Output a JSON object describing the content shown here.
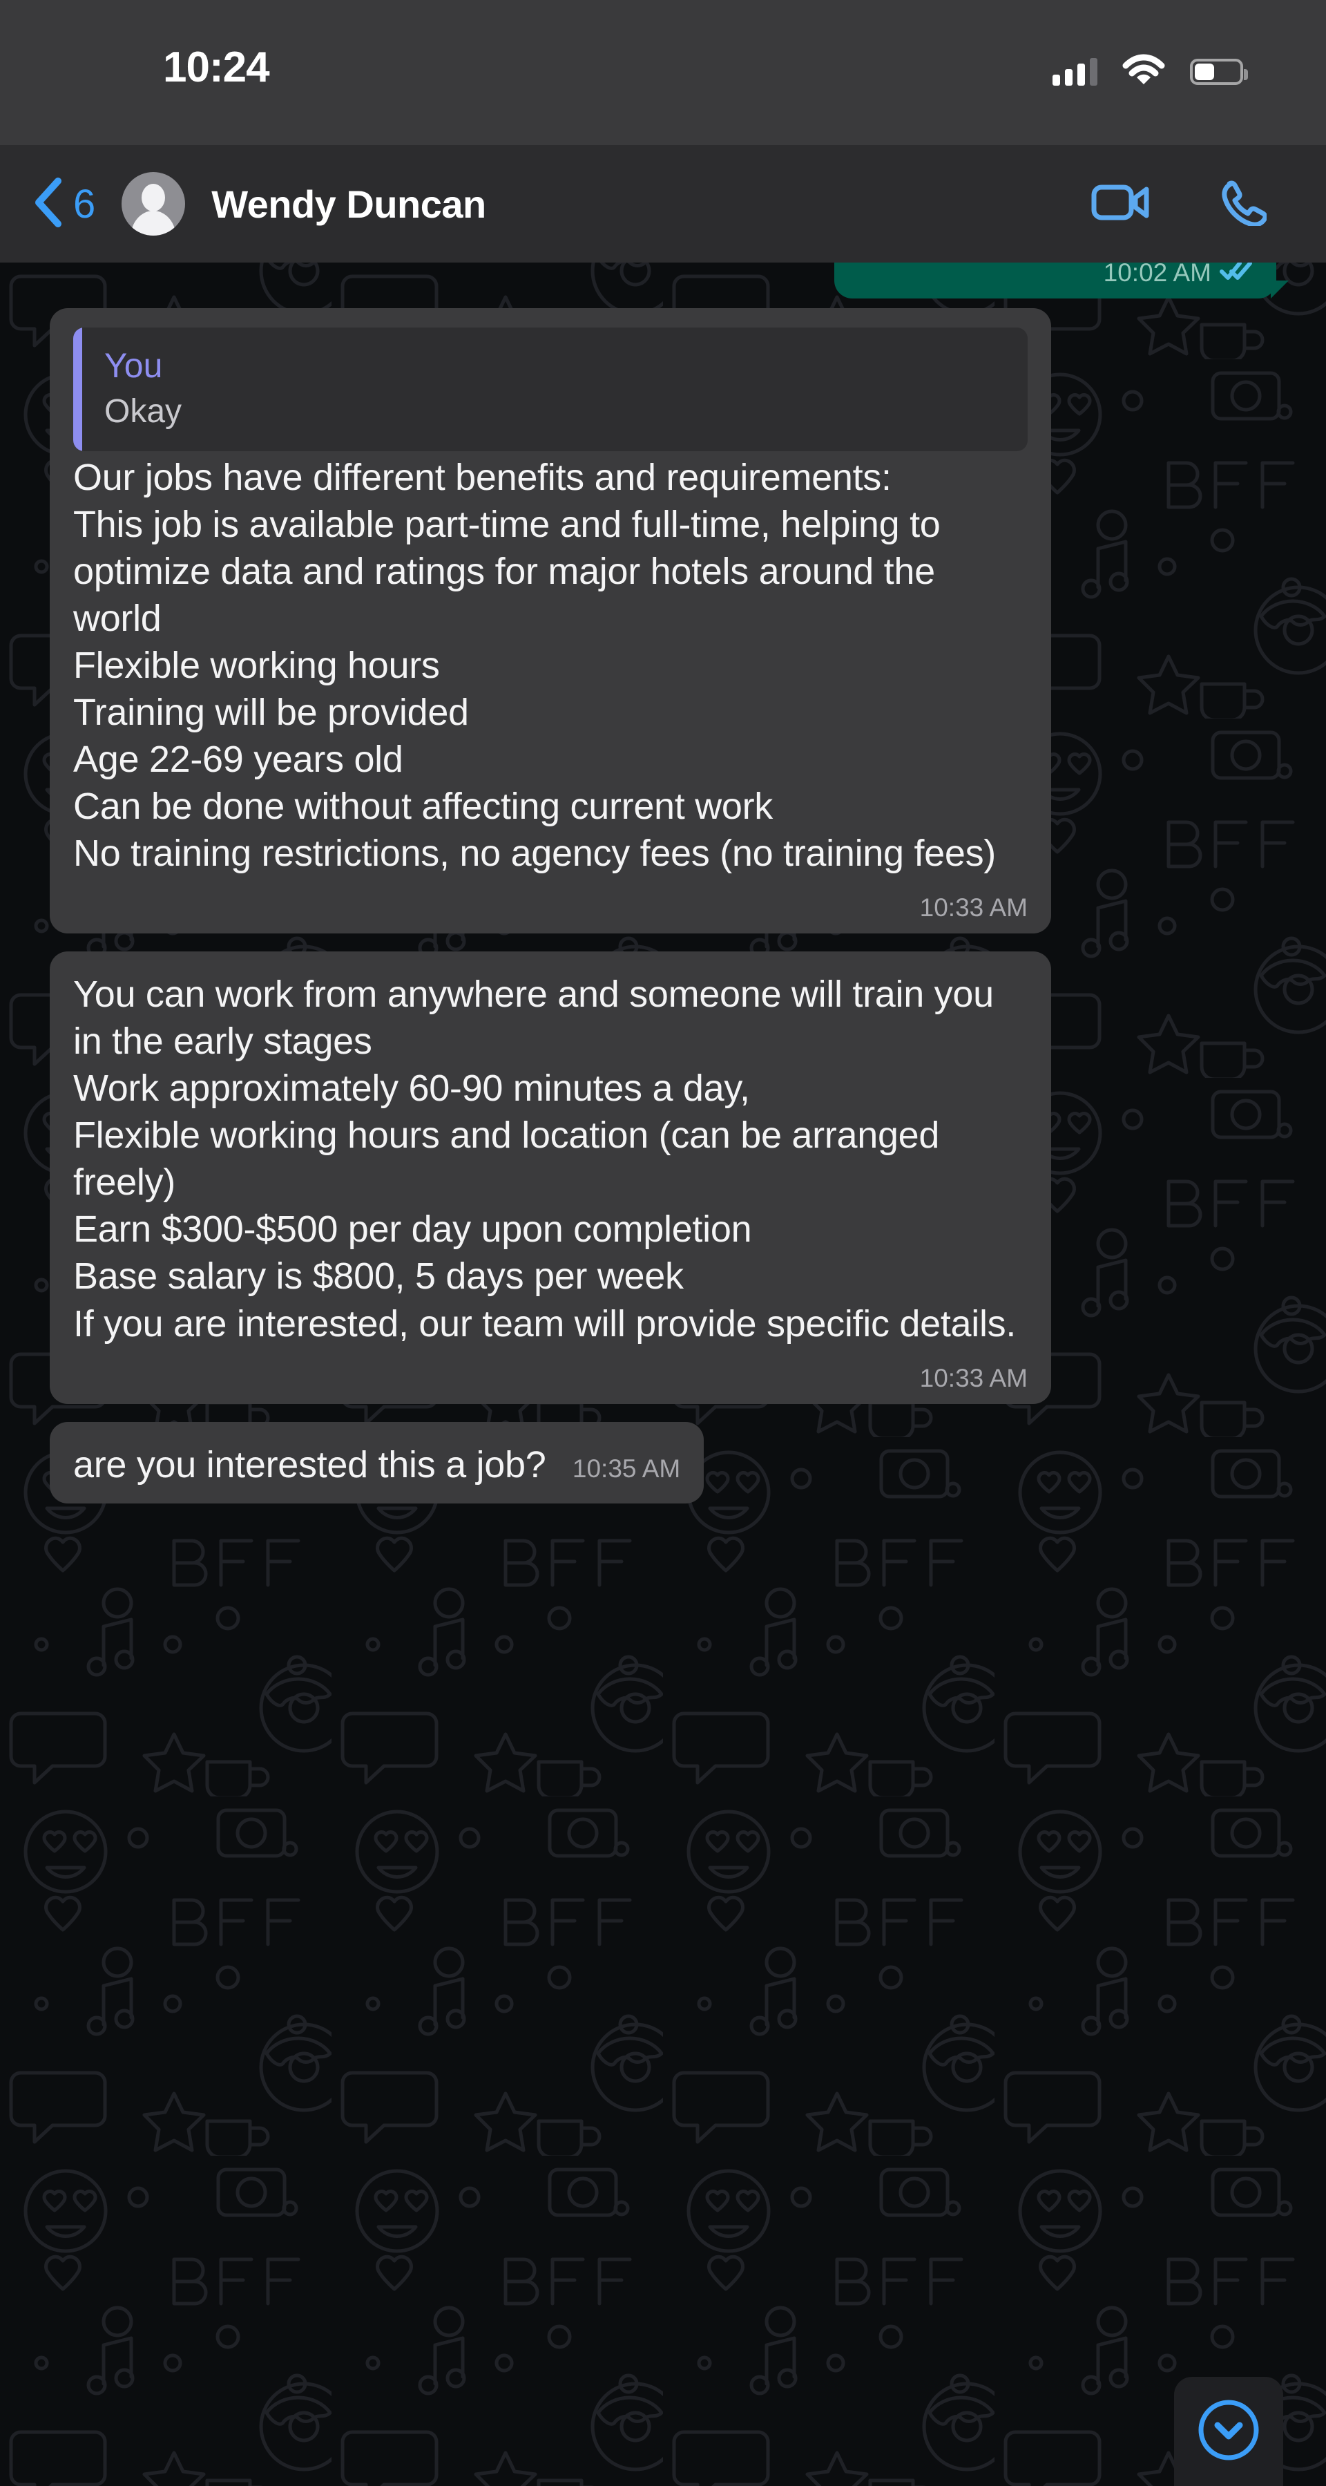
{
  "status_bar": {
    "time": "10:24",
    "signal_icon": "cellular-signal-icon",
    "signal_bars_filled": 3,
    "signal_bars_total": 4,
    "wifi_icon": "wifi-icon",
    "battery_icon": "battery-icon",
    "battery_level_percent": 40
  },
  "header": {
    "back_icon": "back-chevron-icon",
    "unread_count": "6",
    "avatar_icon": "default-contact-avatar-icon",
    "contact_name": "Wendy Duncan",
    "video_call_icon": "video-call-icon",
    "voice_call_icon": "voice-call-icon",
    "accent_color": "#3B9DF7",
    "header_background": "#2C2C2E"
  },
  "theme": {
    "wallpaper_background": "#0B0D0F",
    "doodle_stroke": "#1E2024",
    "incoming_bubble": "#3B3B3D",
    "outgoing_bubble": "#005C4B",
    "quote_accent": "#8E8EF0",
    "timestamp_color": "#A8A8AD",
    "read_receipt_color": "#53BDEB"
  },
  "messages": [
    {
      "id": "msg-clipped-outgoing",
      "direction": "outgoing",
      "text": "",
      "time": "10:02 AM",
      "status": "read",
      "clipped": true
    },
    {
      "id": "msg-job-benefits",
      "direction": "incoming",
      "quote": {
        "author": "You",
        "text": "Okay"
      },
      "text": "Our jobs have different benefits and requirements:\nThis job is available part-time and full-time, helping to optimize data and ratings for major hotels around the world\nFlexible working hours\nTraining will be provided\nAge 22-69 years old\nCan be done without affecting current work\nNo training restrictions, no agency fees (no training fees)",
      "time": "10:33 AM"
    },
    {
      "id": "msg-work-details",
      "direction": "incoming",
      "text": "You can work from anywhere and someone will train you in the early stages\nWork approximately 60-90 minutes a day,\nFlexible working hours and location (can be arranged freely)\nEarn $300-$500 per day upon completion\nBase salary is $800, 5 days per week\nIf you are interested, our team will provide specific details.",
      "time": "10:33 AM"
    },
    {
      "id": "msg-are-you-interested",
      "direction": "incoming",
      "text": "are you interested this a job?",
      "time": "10:35 AM"
    }
  ],
  "scroll_to_bottom": {
    "icon": "chevron-down-circle-icon",
    "color": "#3B9DF7"
  }
}
